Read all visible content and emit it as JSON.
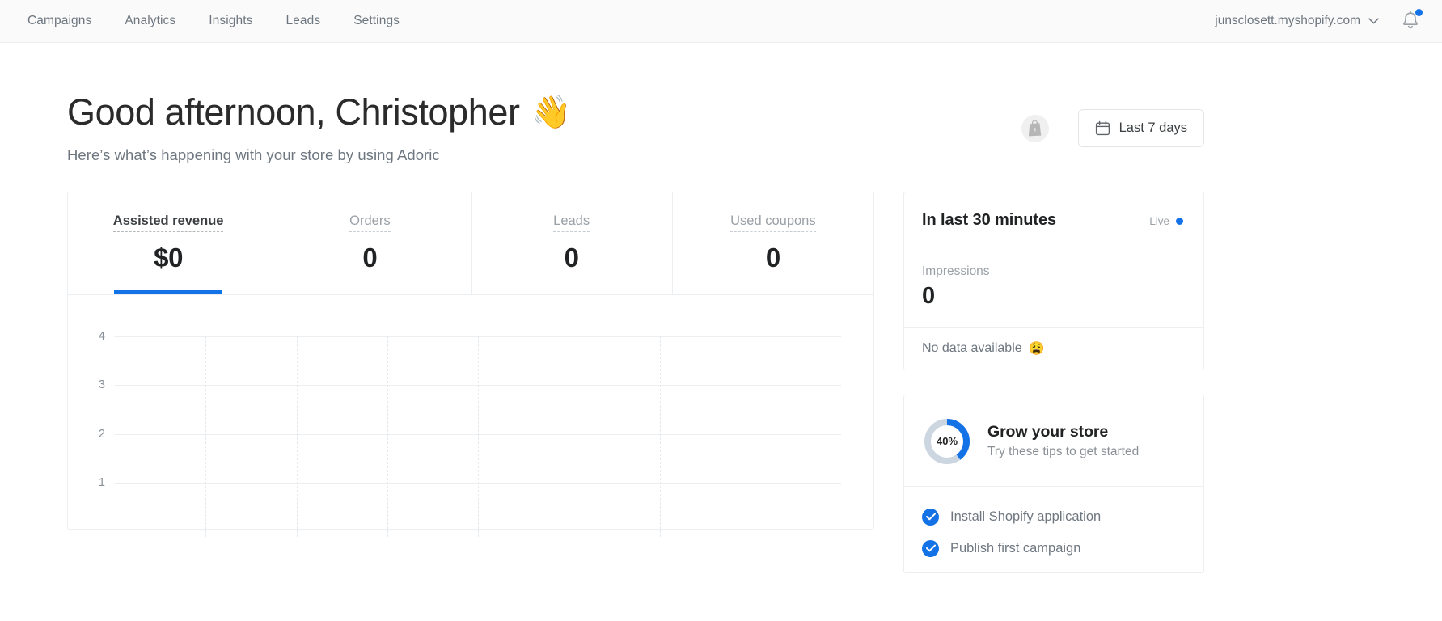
{
  "topbar": {
    "nav": [
      {
        "label": "Campaigns"
      },
      {
        "label": "Analytics"
      },
      {
        "label": "Insights"
      },
      {
        "label": "Leads"
      },
      {
        "label": "Settings"
      }
    ],
    "store": "junsclosett.myshopify.com",
    "store_caret_icon": "chevron-down-icon",
    "notifications_icon": "bell-icon",
    "notification_badge": true
  },
  "hero": {
    "greeting": "Good afternoon, Christopher",
    "wave_emoji": "👋",
    "subtitle": "Here’s what’s happening with your store by using Adoric",
    "shopify_icon": "shopify-bag-icon",
    "date_range_label": "Last 7 days",
    "calendar_icon": "calendar-icon"
  },
  "kpi": {
    "tabs": [
      {
        "label": "Assisted revenue",
        "value": "$0",
        "active": true
      },
      {
        "label": "Orders",
        "value": "0",
        "active": false
      },
      {
        "label": "Leads",
        "value": "0",
        "active": false
      },
      {
        "label": "Used coupons",
        "value": "0",
        "active": false
      }
    ],
    "accent_color": "#1373e6"
  },
  "chart_data": {
    "type": "line",
    "title": "Assisted revenue",
    "xlabel": "",
    "ylabel": "",
    "categories": [
      "",
      "",
      "",
      "",
      "",
      "",
      ""
    ],
    "values": [
      0,
      0,
      0,
      0,
      0,
      0,
      0
    ],
    "yticks": [
      "4",
      "3",
      "2",
      "1"
    ],
    "ylim": [
      0,
      4
    ],
    "grid": true,
    "legend": "none",
    "series": [
      {
        "name": "Assisted revenue",
        "values": [
          0,
          0,
          0,
          0,
          0,
          0,
          0
        ]
      }
    ]
  },
  "live_card": {
    "title": "In last 30 minutes",
    "badge_label": "Live",
    "badge_color": "#1373e6",
    "metric_label": "Impressions",
    "metric_value": "0",
    "empty_text": "No data available",
    "empty_emoji": "😩"
  },
  "grow_card": {
    "progress_label": "40%",
    "progress_value": 40,
    "title": "Grow your store",
    "subtitle": "Try these tips to get started",
    "items": [
      {
        "label": "Install Shopify application",
        "done": true
      },
      {
        "label": "Publish first campaign",
        "done": true
      }
    ]
  }
}
